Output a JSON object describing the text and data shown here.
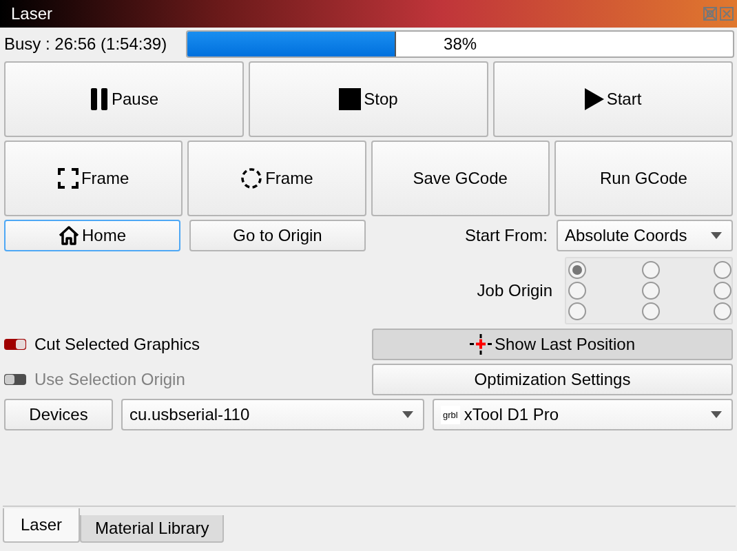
{
  "window": {
    "title": "Laser"
  },
  "status": {
    "text": "Busy : 26:56 (1:54:39)",
    "level": 0.38,
    "reading": "38%"
  },
  "control_buttons": [
    {
      "label": "Pause",
      "kind": "pause"
    },
    {
      "label": "Stop",
      "kind": "stop"
    },
    {
      "label": "Start",
      "kind": "play"
    }
  ],
  "action_buttons": [
    {
      "label": "Frame",
      "kind": "frame-rect"
    },
    {
      "label": "Frame",
      "kind": "frame-circle"
    },
    {
      "label": "Save GCode",
      "kind": "plain"
    },
    {
      "label": "Run GCode",
      "kind": "plain"
    }
  ],
  "nav_buttons": [
    {
      "label": "Home",
      "kind": "home",
      "focused": true
    },
    {
      "label": "Go to Origin",
      "kind": "plain",
      "focused": false
    }
  ],
  "start_from": {
    "label": "Start From:",
    "value": "Absolute Coords"
  },
  "job_origin": {
    "label": "Job Origin",
    "options": [
      {
        "selected": true
      },
      {
        "selected": false
      },
      {
        "selected": false
      },
      {
        "selected": false
      },
      {
        "selected": false
      },
      {
        "selected": false
      },
      {
        "selected": false
      },
      {
        "selected": false
      },
      {
        "selected": false
      }
    ]
  },
  "toggles": [
    {
      "label": "Cut Selected Graphics",
      "on": true,
      "disabled": false
    },
    {
      "label": "Use Selection Origin",
      "on": false,
      "disabled": true
    }
  ],
  "side_buttons": [
    {
      "label": "Show Last Position",
      "kind": "crosshair",
      "checked": true
    },
    {
      "label": "Optimization Settings",
      "kind": "plain",
      "checked": false
    }
  ],
  "devices": {
    "button": "Devices",
    "port": "cu.usbserial-110",
    "device_logo": "grbl",
    "device": "xTool D1 Pro"
  },
  "tabs": [
    {
      "label": "Laser",
      "selected": true
    },
    {
      "label": "Material Library",
      "selected": false
    }
  ]
}
